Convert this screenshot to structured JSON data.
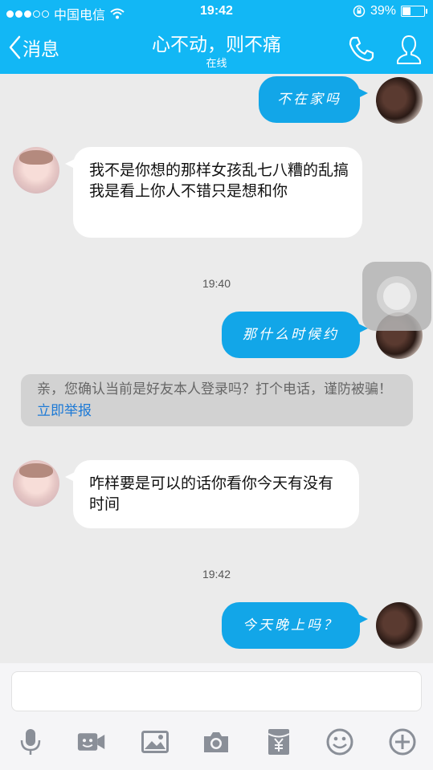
{
  "status": {
    "carrier": "中国电信",
    "time": "19:42",
    "battery_percent": "39%",
    "battery_level": 0.39
  },
  "header": {
    "back_label": "消息",
    "title": "心不动，则不痛",
    "subtitle": "在线"
  },
  "messages": [
    {
      "dir": "out",
      "text": "不在家吗"
    },
    {
      "dir": "in",
      "text": "我不是你想的那样女孩乱七八糟的乱搞我是看上你人不错只是想和你"
    },
    {
      "dir": "out",
      "text": "那什么时候约"
    },
    {
      "dir": "in",
      "text": "咋样要是可以的话你看你今天有没有时间"
    },
    {
      "dir": "out",
      "text": "今天晚上吗？"
    }
  ],
  "timestamps": [
    "19:40",
    "19:42"
  ],
  "notice": {
    "text": "亲，您确认当前是好友本人登录吗？打个电话，谨防被骗！",
    "link": "立即举报"
  },
  "toolbar": {
    "icons": [
      "microphone-icon",
      "video-call-icon",
      "image-icon",
      "camera-icon",
      "red-packet-icon",
      "emoji-icon",
      "plus-icon"
    ]
  },
  "colors": {
    "header_bg": "#12b7f5",
    "bubble_out": "#12a6e8",
    "bubble_in": "#ffffff",
    "link": "#1d7ad6"
  }
}
